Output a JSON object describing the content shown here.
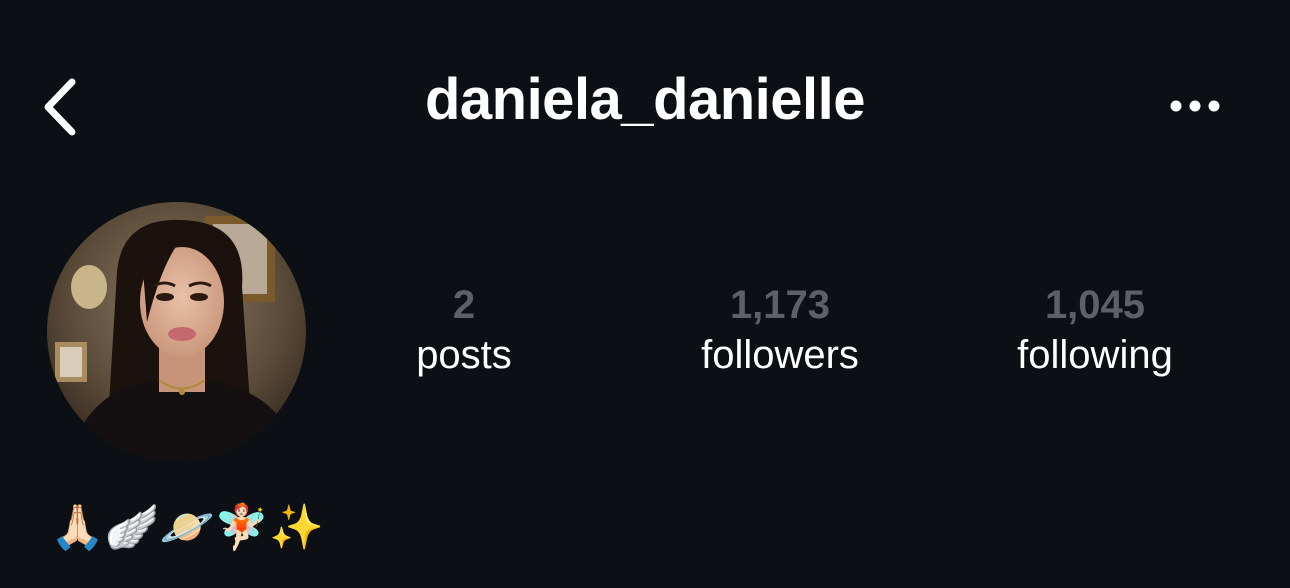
{
  "header": {
    "username": "daniela_danielle",
    "back_icon": "chevron-left-icon",
    "more_icon": "ellipsis-horizontal-icon"
  },
  "profile": {
    "avatar_icon": "profile-photo-avatar",
    "stats": [
      {
        "value": "2",
        "label": "posts"
      },
      {
        "value": "1,173",
        "label": "followers"
      },
      {
        "value": "1,045",
        "label": "following"
      }
    ],
    "bio": "🙏🏻🪽🪐🧚🏻✨"
  },
  "colors": {
    "background": "#0c0f14",
    "text": "#ffffff",
    "muted_number": "#5c6068"
  }
}
